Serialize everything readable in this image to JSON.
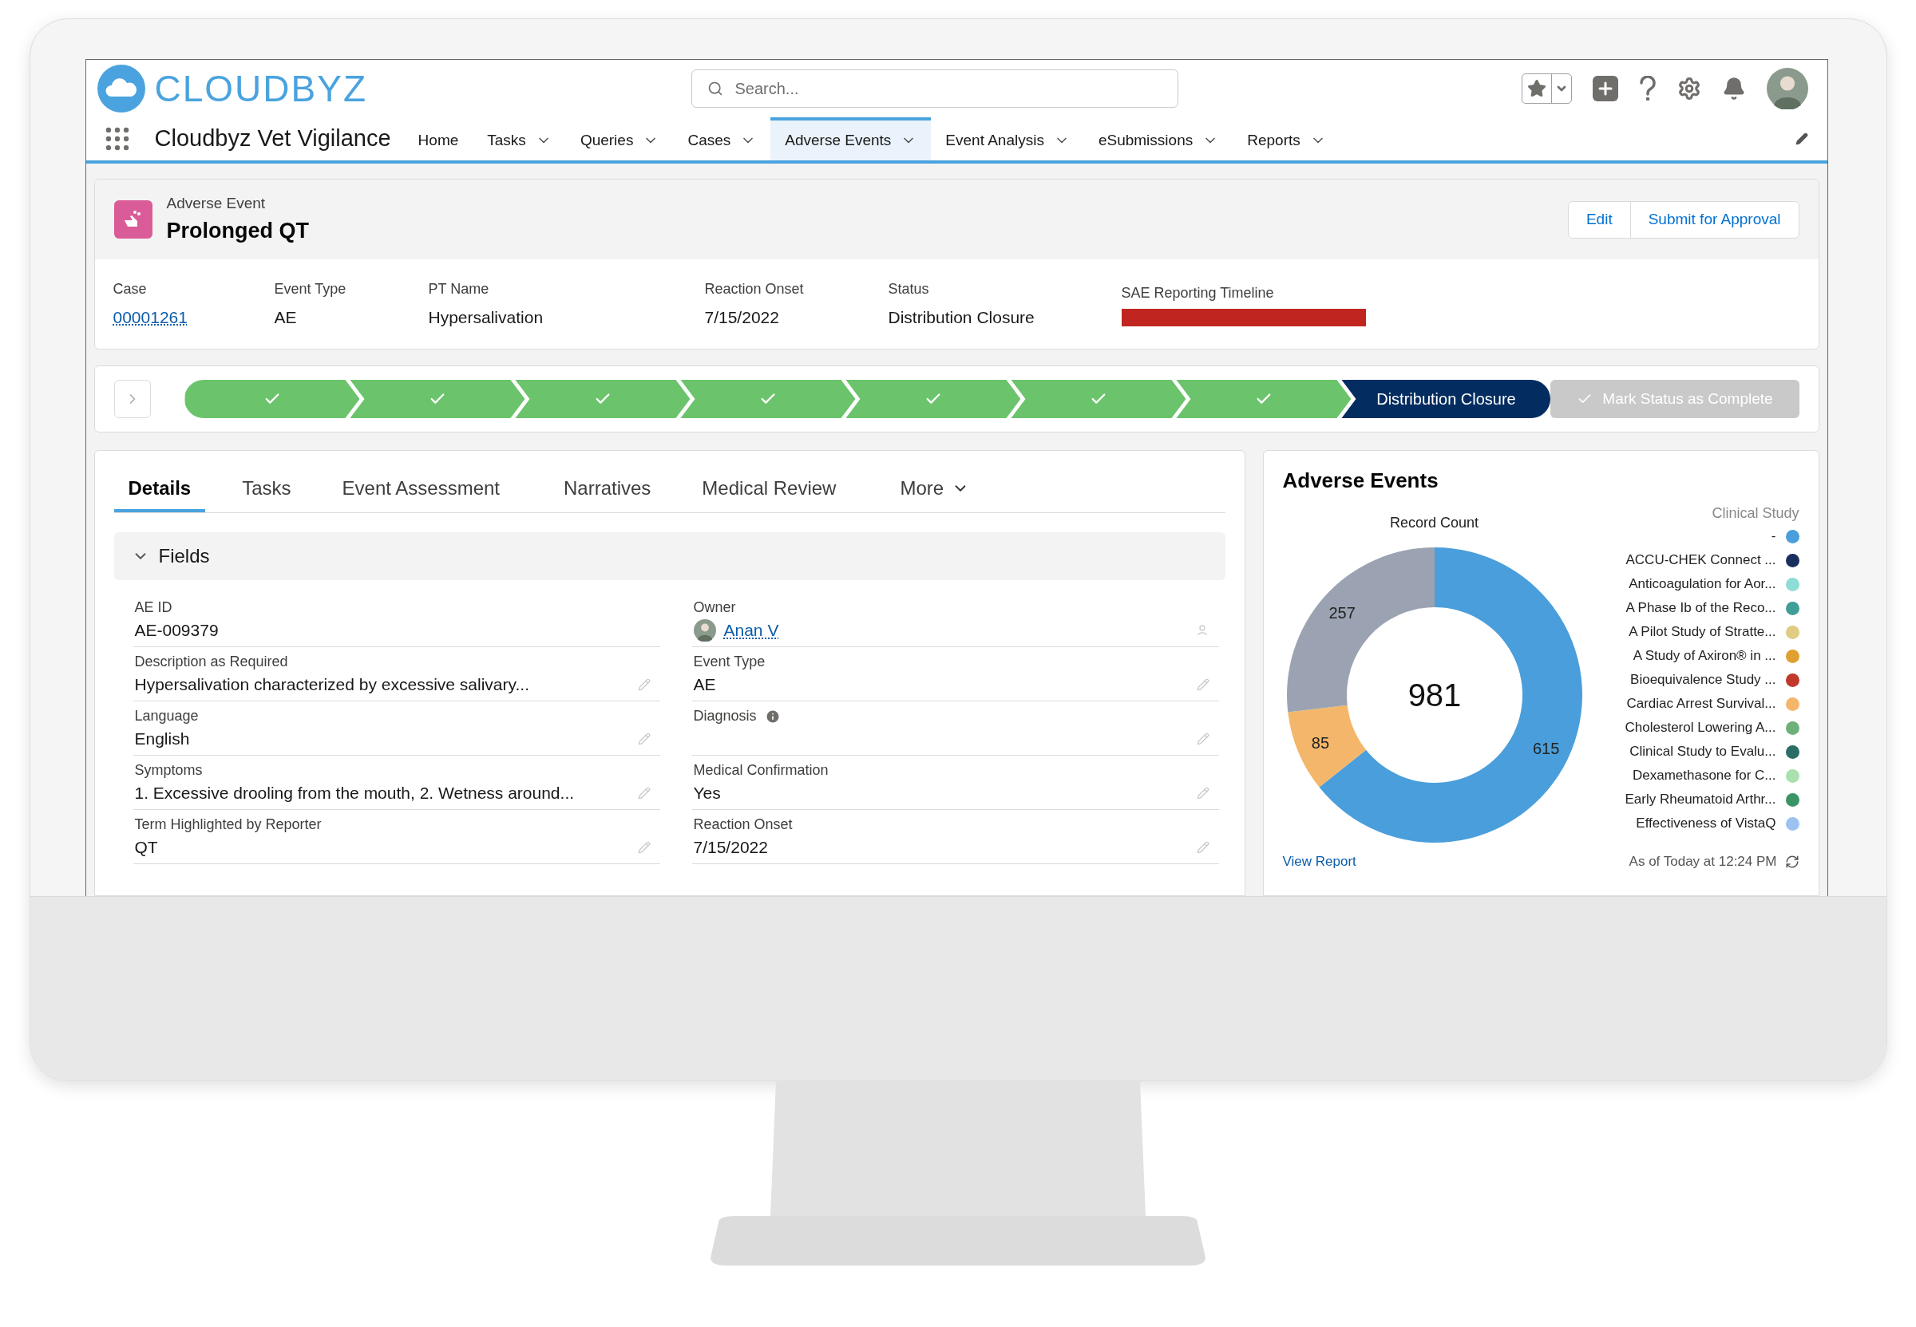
{
  "app": {
    "logo": "**CLOUD**BYZ",
    "name": "Cloudbyz Vet Vigilance"
  },
  "search": {
    "placeholder": "Search..."
  },
  "nav": [
    {
      "label": "Home",
      "selected": false,
      "menu": false
    },
    {
      "label": "Tasks",
      "selected": false,
      "menu": true
    },
    {
      "label": "Queries",
      "selected": false,
      "menu": true
    },
    {
      "label": "Cases",
      "selected": false,
      "menu": true
    },
    {
      "label": "Adverse Events",
      "selected": true,
      "menu": true
    },
    {
      "label": "Event Analysis",
      "selected": false,
      "menu": true
    },
    {
      "label": "eSubmissions",
      "selected": false,
      "menu": true
    },
    {
      "label": "Reports",
      "selected": false,
      "menu": true
    }
  ],
  "record": {
    "type": "Adverse Event",
    "title": "Prolonged QT",
    "actions": [
      "Edit",
      "Submit for Approval"
    ]
  },
  "highlights": [
    {
      "label": "Case",
      "kind": "link",
      "value": "00001261"
    },
    {
      "label": "Event Type",
      "kind": "text",
      "value": "AE"
    },
    {
      "label": "PT Name",
      "kind": "text",
      "value": "Hypersalivation"
    },
    {
      "label": "Reaction Onset",
      "kind": "text",
      "value": "7/15/2022"
    },
    {
      "label": "Status",
      "kind": "text",
      "value": "Distribution Closure"
    },
    {
      "label": "SAE Reporting Timeline",
      "kind": "bar"
    }
  ],
  "path": {
    "stages": [
      {
        "complete": true,
        "selected": false
      },
      {
        "complete": true,
        "selected": false
      },
      {
        "complete": true,
        "selected": false
      },
      {
        "complete": true,
        "selected": false
      },
      {
        "complete": true,
        "selected": false
      },
      {
        "complete": true,
        "selected": false
      },
      {
        "complete": true,
        "selected": false
      },
      {
        "label": "Distribution Closure",
        "complete": false,
        "selected": true
      }
    ],
    "action": {
      "label": "Mark Status as Complete",
      "disabled": true
    }
  },
  "tabs": [
    {
      "label": "Details",
      "selected": true,
      "menu": false
    },
    {
      "label": "Tasks",
      "selected": false,
      "menu": false
    },
    {
      "label": "Event Assessment",
      "selected": false,
      "menu": false
    },
    {
      "label": "Narratives",
      "selected": false,
      "menu": false
    },
    {
      "label": "Medical Review",
      "selected": false,
      "menu": false
    },
    {
      "label": "More",
      "selected": false,
      "menu": true
    }
  ],
  "section": {
    "title": "Fields",
    "expanded": true
  },
  "fields": {
    "left": [
      {
        "label": "AE ID",
        "kind": "text",
        "value": "AE-009379",
        "editable": false
      },
      {
        "label": "Description as Required",
        "kind": "text",
        "value": "Hypersalivation characterized by excessive salivary...",
        "editable": true
      },
      {
        "label": "Language",
        "kind": "text",
        "value": "English",
        "editable": true
      },
      {
        "label": "Symptoms",
        "kind": "text",
        "value": "1. Excessive drooling from the mouth, 2. Wetness around...",
        "editable": true
      },
      {
        "label": "Term Highlighted by Reporter",
        "kind": "text",
        "value": "QT",
        "editable": true
      }
    ],
    "right": [
      {
        "label": "Owner",
        "kind": "user",
        "value": "Anan V",
        "editable": false
      },
      {
        "label": "Event Type",
        "kind": "text",
        "value": "AE",
        "editable": true
      },
      {
        "label": "Diagnosis",
        "kind": "text",
        "info": true,
        "editable": true
      },
      {
        "label": "Medical Confirmation",
        "kind": "text",
        "value": "Yes",
        "editable": true
      },
      {
        "label": "Reaction Onset",
        "kind": "text",
        "value": "7/15/2022",
        "editable": true
      }
    ]
  },
  "report": {
    "title": "Adverse Events",
    "chart_data": {
      "type": "donut",
      "title": "Record Count",
      "annotations": [
        {
          "text": "981"
        }
      ],
      "data_labels": true,
      "values": [
        615,
        85,
        257
      ],
      "colors": [
        "#4a9edb",
        "#f4b66a",
        "#9ba3b2"
      ]
    },
    "legend_title": "Clinical Study",
    "legend": [
      {
        "label": "-",
        "color": "#4a9edb"
      },
      {
        "label": "ACCU-CHEK Connect ...",
        "color": "#1b2f5e"
      },
      {
        "label": "Anticoagulation for Aor...",
        "color": "#8ddcd6"
      },
      {
        "label": "A Phase Ib of the Reco...",
        "color": "#3f9e98"
      },
      {
        "label": "A Pilot Study of Stratte...",
        "color": "#e0cc82"
      },
      {
        "label": "A Study of Axiron® in ...",
        "color": "#e0a030"
      },
      {
        "label": "Bioequivalence Study ...",
        "color": "#c0392b"
      },
      {
        "label": "Cardiac Arrest Survival...",
        "color": "#f4b66a"
      },
      {
        "label": "Cholesterol Lowering A...",
        "color": "#6fb07a"
      },
      {
        "label": "Clinical Study to Evalu...",
        "color": "#2a6e66"
      },
      {
        "label": "Dexamethasone for C...",
        "color": "#a8e0b0"
      },
      {
        "label": "Early Rheumatoid Arthr...",
        "color": "#3b9466"
      },
      {
        "label": "Effectiveness of VistaQ",
        "color": "#9cc3f0"
      }
    ],
    "footer": {
      "link": "View Report",
      "timestamp": "As of Today at 12:24 PM"
    }
  }
}
